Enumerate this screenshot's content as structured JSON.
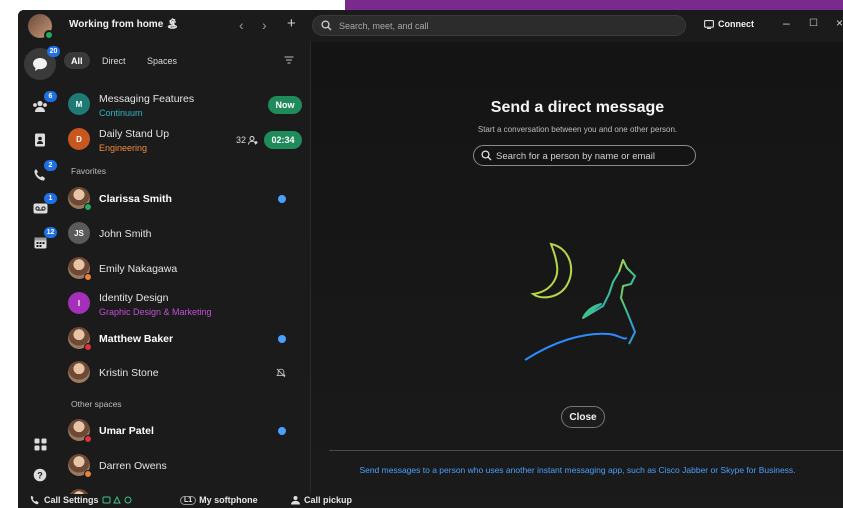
{
  "titlebar": {
    "status": "Working from home 🏝",
    "back": "‹",
    "forward": "›",
    "new": "+",
    "search_placeholder": "Search, meet, and call",
    "connect": "Connect",
    "minimize": "–",
    "maximize": "☐",
    "close": "×"
  },
  "rail": {
    "messaging_badge": "20",
    "teams_badge": "6",
    "calling_badge": "2",
    "voicemail_badge": "1",
    "calendar_badge": "12"
  },
  "filters": {
    "all": "All",
    "direct": "Direct",
    "spaces": "Spaces"
  },
  "spaces": [
    {
      "initial": "M",
      "title": "Messaging Features",
      "subtitle": "Continuum",
      "pill": "Now"
    },
    {
      "initial": "D",
      "title": "Daily Stand Up",
      "subtitle": "Engineering",
      "participants": "32",
      "pill": "02:34"
    }
  ],
  "sections": {
    "favorites": "Favorites",
    "other": "Other spaces"
  },
  "favorites": [
    {
      "name": "Clarissa Smith"
    },
    {
      "initial": "JS",
      "name": "John Smith"
    },
    {
      "name": "Emily Nakagawa"
    },
    {
      "initial": "I",
      "name": "Identity Design",
      "subtitle": "Graphic Design & Marketing"
    },
    {
      "name": "Matthew Baker"
    },
    {
      "name": "Kristin Stone"
    }
  ],
  "other_spaces": [
    {
      "name": "Umar Patel"
    },
    {
      "name": "Darren Owens"
    }
  ],
  "main": {
    "title": "Send a direct message",
    "subtitle": "Start a conversation between you and one other person.",
    "search_placeholder": "Search for a person by name or email",
    "close": "Close",
    "footnote": "Send messages to a person who uses another instant messaging app, such as Cisco Jabber or Skype for Business."
  },
  "statusbar": {
    "call_settings": "Call Settings",
    "line": "L1",
    "softphone": "My softphone",
    "pickup": "Call pickup"
  },
  "colors": {
    "accent_blue": "#4aa0ff",
    "badge_blue": "#1f6fe5",
    "green_pill": "#1f8a5a",
    "space_subtitle_teal": "#2fb6c2",
    "engineering_orange": "#f08a3c",
    "design_purple": "#c44fd6"
  }
}
